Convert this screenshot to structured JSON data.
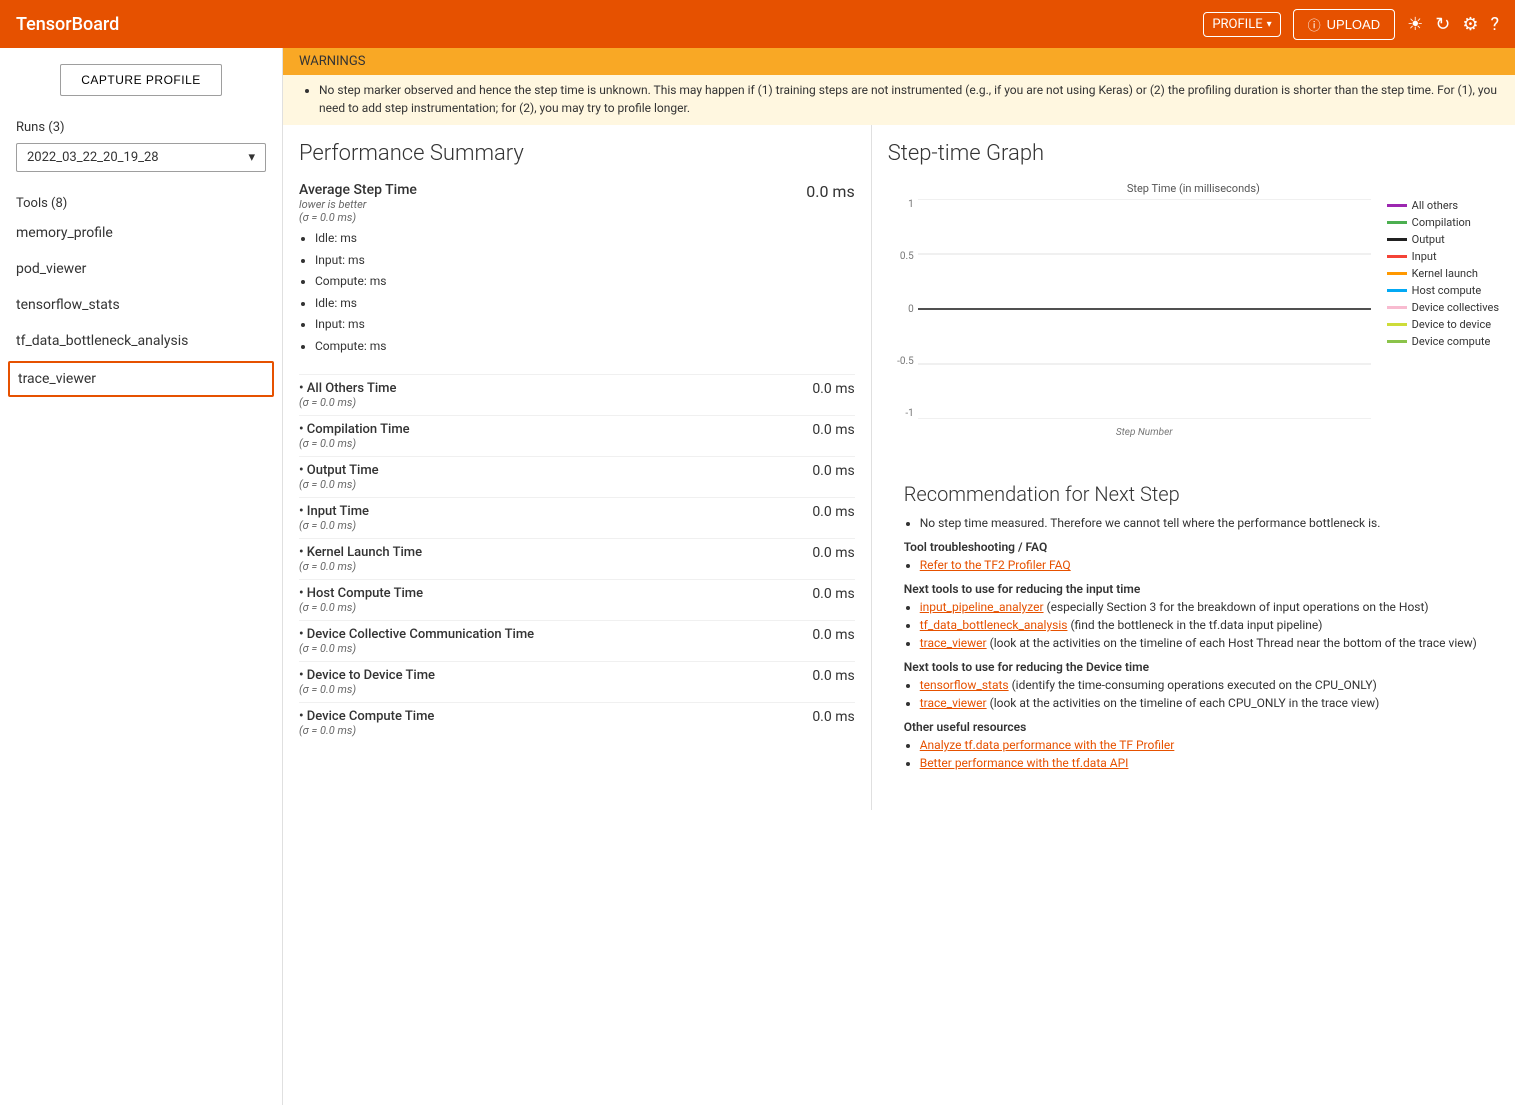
{
  "header": {
    "title": "TensorBoard",
    "profile_label": "PROFILE",
    "upload_label": "UPLOAD"
  },
  "sidebar": {
    "capture_btn": "CAPTURE PROFILE",
    "runs_label": "Runs (3)",
    "runs_value": "2022_03_22_20_19_28",
    "tools_label": "Tools (8)",
    "tools": [
      {
        "id": "memory_profile",
        "label": "memory_profile",
        "active": false
      },
      {
        "id": "pod_viewer",
        "label": "pod_viewer",
        "active": false
      },
      {
        "id": "tensorflow_stats",
        "label": "tensorflow_stats",
        "active": false
      },
      {
        "id": "tf_data_bottleneck_analysis",
        "label": "tf_data_bottleneck_analysis",
        "active": false
      },
      {
        "id": "trace_viewer",
        "label": "trace_viewer",
        "active": true
      }
    ]
  },
  "warnings": {
    "title": "WARNINGS",
    "text": "No step marker observed and hence the step time is unknown. This may happen if (1) training steps are not instrumented (e.g., if you are not using Keras) or (2) the profiling duration is shorter than the step time. For (1), you need to add step instrumentation; for (2), you may try to profile longer."
  },
  "performance": {
    "title": "Performance Summary",
    "avg_step": {
      "label": "Average Step Time",
      "sublabel": "lower is better",
      "sigma": "(σ = 0.0 ms)",
      "value": "0.0 ms",
      "bullets": [
        "Idle: ms",
        "Input: ms",
        "Compute: ms",
        "Idle: ms",
        "Input: ms",
        "Compute: ms"
      ]
    },
    "metrics": [
      {
        "label": "All Others Time",
        "sigma": "(σ = 0.0 ms)",
        "value": "0.0 ms"
      },
      {
        "label": "Compilation Time",
        "sigma": "(σ = 0.0 ms)",
        "value": "0.0 ms"
      },
      {
        "label": "Output Time",
        "sigma": "(σ = 0.0 ms)",
        "value": "0.0 ms"
      },
      {
        "label": "Input Time",
        "sigma": "(σ = 0.0 ms)",
        "value": "0.0 ms"
      },
      {
        "label": "Kernel Launch Time",
        "sigma": "(σ = 0.0 ms)",
        "value": "0.0 ms"
      },
      {
        "label": "Host Compute Time",
        "sigma": "(σ = 0.0 ms)",
        "value": "0.0 ms"
      },
      {
        "label": "Device Collective Communication Time",
        "sigma": "(σ = 0.0 ms)",
        "value": "0.0 ms"
      },
      {
        "label": "Device to Device Time",
        "sigma": "(σ = 0.0 ms)",
        "value": "0.0 ms"
      },
      {
        "label": "Device Compute Time",
        "sigma": "(σ = 0.0 ms)",
        "value": "0.0 ms"
      }
    ]
  },
  "graph": {
    "title": "Step-time Graph",
    "y_label": "Step Time (in milliseconds)",
    "x_label": "Step Number",
    "y_ticks": [
      "1",
      "0.5",
      "0",
      "-0.5",
      "-1"
    ],
    "legend": [
      {
        "label": "All others",
        "color": "#9c27b0"
      },
      {
        "label": "Compilation",
        "color": "#4caf50"
      },
      {
        "label": "Output",
        "color": "#212121"
      },
      {
        "label": "Input",
        "color": "#f44336"
      },
      {
        "label": "Kernel launch",
        "color": "#ff9800"
      },
      {
        "label": "Host compute",
        "color": "#03a9f4"
      },
      {
        "label": "Device collectives",
        "color": "#f8bbd0"
      },
      {
        "label": "Device to device",
        "color": "#cddc39"
      },
      {
        "label": "Device compute",
        "color": "#8bc34a"
      }
    ]
  },
  "recommendation": {
    "title": "Recommendation for Next Step",
    "no_step": "No step time measured. Therefore we cannot tell where the performance bottleneck is.",
    "faq_title": "Tool troubleshooting / FAQ",
    "faq_link": "Refer to the TF2 Profiler FAQ",
    "input_title": "Next tools to use for reducing the input time",
    "input_links": [
      {
        "label": "input_pipeline_analyzer",
        "suffix": " (especially Section 3 for the breakdown of input operations on the Host)"
      },
      {
        "label": "tf_data_bottleneck_analysis",
        "suffix": " (find the bottleneck in the tf.data input pipeline)"
      },
      {
        "label": "trace_viewer",
        "suffix": " (look at the activities on the timeline of each Host Thread near the bottom of the trace view)"
      }
    ],
    "device_title": "Next tools to use for reducing the Device time",
    "device_links": [
      {
        "label": "tensorflow_stats",
        "suffix": " (identify the time-consuming operations executed on the CPU_ONLY)"
      },
      {
        "label": "trace_viewer",
        "suffix": " (look at the activities on the timeline of each CPU_ONLY in the trace view)"
      }
    ],
    "other_title": "Other useful resources",
    "other_links": [
      {
        "label": "Analyze tf.data performance with the TF Profiler"
      },
      {
        "label": "Better performance with the tf.data API"
      }
    ]
  }
}
